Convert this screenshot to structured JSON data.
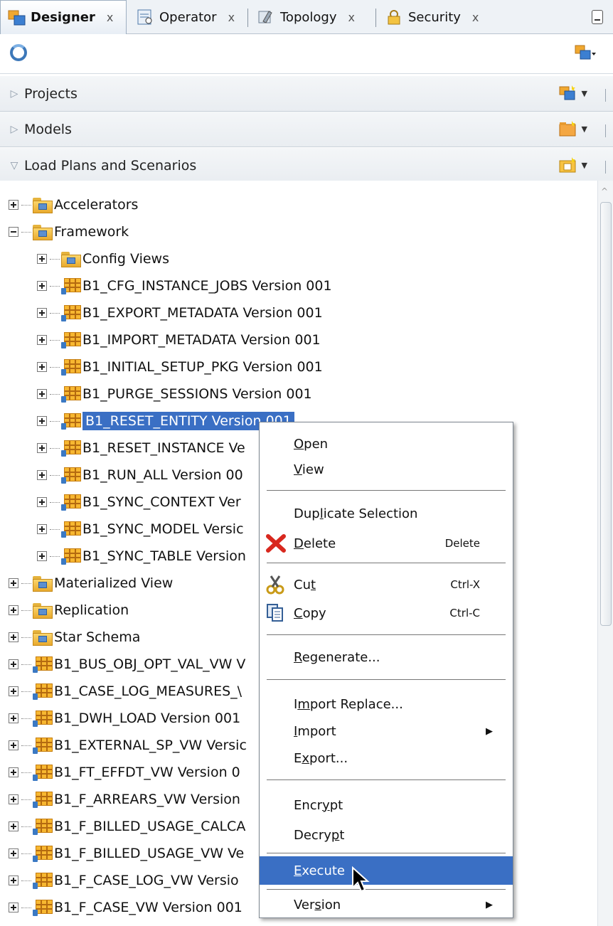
{
  "tabs": [
    {
      "label": "Designer",
      "icon": "designer-icon",
      "active": true
    },
    {
      "label": "Operator",
      "icon": "operator-icon",
      "active": false
    },
    {
      "label": "Topology",
      "icon": "topology-icon",
      "active": false
    },
    {
      "label": "Security",
      "icon": "security-icon",
      "active": false
    }
  ],
  "tab_close": "x",
  "accordions": {
    "projects": "Projects",
    "models": "Models",
    "load_plans": "Load Plans and Scenarios"
  },
  "tree": {
    "top_folders": {
      "accelerators": "Accelerators",
      "framework": "Framework"
    },
    "framework_children": {
      "config_views": "Config Views",
      "items": [
        "B1_CFG_INSTANCE_JOBS Version 001",
        "B1_EXPORT_METADATA Version 001",
        "B1_IMPORT_METADATA Version 001",
        "B1_INITIAL_SETUP_PKG Version 001",
        "B1_PURGE_SESSIONS Version 001",
        "B1_RESET_ENTITY Version 001",
        "B1_RESET_INSTANCE Ve",
        "B1_RUN_ALL Version 00",
        "B1_SYNC_CONTEXT Ver",
        "B1_SYNC_MODEL Versic",
        "B1_SYNC_TABLE Version"
      ]
    },
    "folders_after": {
      "materialized": "Materialized View",
      "replication": "Replication",
      "star_schema": "Star Schema"
    },
    "scenarios": [
      "B1_BUS_OBJ_OPT_VAL_VW V",
      "B1_CASE_LOG_MEASURES_\\",
      "B1_DWH_LOAD Version 001",
      "B1_EXTERNAL_SP_VW Versic",
      "B1_FT_EFFDT_VW Version 0",
      "B1_F_ARREARS_VW Version",
      "B1_F_BILLED_USAGE_CALCA",
      "B1_F_BILLED_USAGE_VW Ve",
      "B1_F_CASE_LOG_VW Versio",
      "B1_F_CASE_VW Version 001"
    ]
  },
  "context_menu": {
    "open": {
      "pre": "",
      "u": "O",
      "post": "pen"
    },
    "view": {
      "pre": "",
      "u": "V",
      "post": "iew"
    },
    "duplicate": {
      "pre": "Dup",
      "u": "l",
      "post": "icate Selection"
    },
    "delete": {
      "pre": "",
      "u": "D",
      "post": "elete",
      "shortcut": "Delete"
    },
    "cut": {
      "pre": "Cu",
      "u": "t",
      "post": "",
      "shortcut": "Ctrl-X"
    },
    "copy": {
      "pre": "",
      "u": "C",
      "post": "opy",
      "shortcut": "Ctrl-C"
    },
    "regenerate": {
      "pre": "",
      "u": "R",
      "post": "egenerate..."
    },
    "import_replace": {
      "pre": "I",
      "u": "m",
      "post": "port Replace..."
    },
    "import": {
      "pre": "",
      "u": "I",
      "post": "mport"
    },
    "export": {
      "pre": "E",
      "u": "x",
      "post": "port..."
    },
    "encrypt": {
      "pre": "Encr",
      "u": "y",
      "post": "pt"
    },
    "decrypt": {
      "pre": "Decry",
      "u": "p",
      "post": "t"
    },
    "execute": {
      "pre": "",
      "u": "E",
      "post": "xecute"
    },
    "version": {
      "pre": "Ver",
      "u": "s",
      "post": "ion"
    }
  },
  "colors": {
    "selection": "#3a6fc4",
    "folder": "#f2c14e",
    "scenario": "#f7b731"
  }
}
